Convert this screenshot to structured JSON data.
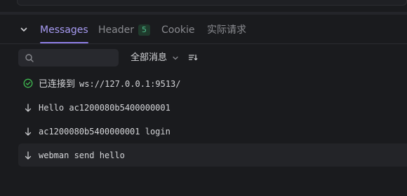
{
  "tabs": [
    {
      "label": "Messages",
      "active": true
    },
    {
      "label": "Header",
      "badge": "5"
    },
    {
      "label": "Cookie"
    },
    {
      "label": "实际请求"
    }
  ],
  "toolbar": {
    "search_placeholder": "",
    "search_value": "",
    "filter_label": "全部消息",
    "sort_icon": "sort-icon"
  },
  "messages": [
    {
      "icon": "connected-check-icon",
      "prefix": "已连接到",
      "text": "ws://127.0.0.1:9513/",
      "status_color": "#3fb950"
    },
    {
      "icon": "incoming-arrow-icon",
      "text": "Hello ac1200080b5400000001"
    },
    {
      "icon": "incoming-arrow-icon",
      "text": "ac1200080b5400000001 login"
    },
    {
      "icon": "incoming-arrow-icon",
      "text": "webman send hello",
      "selected": true
    }
  ],
  "colors": {
    "background": "#1a1b1e",
    "accent": "#8f7fe8",
    "success": "#3fb950"
  }
}
